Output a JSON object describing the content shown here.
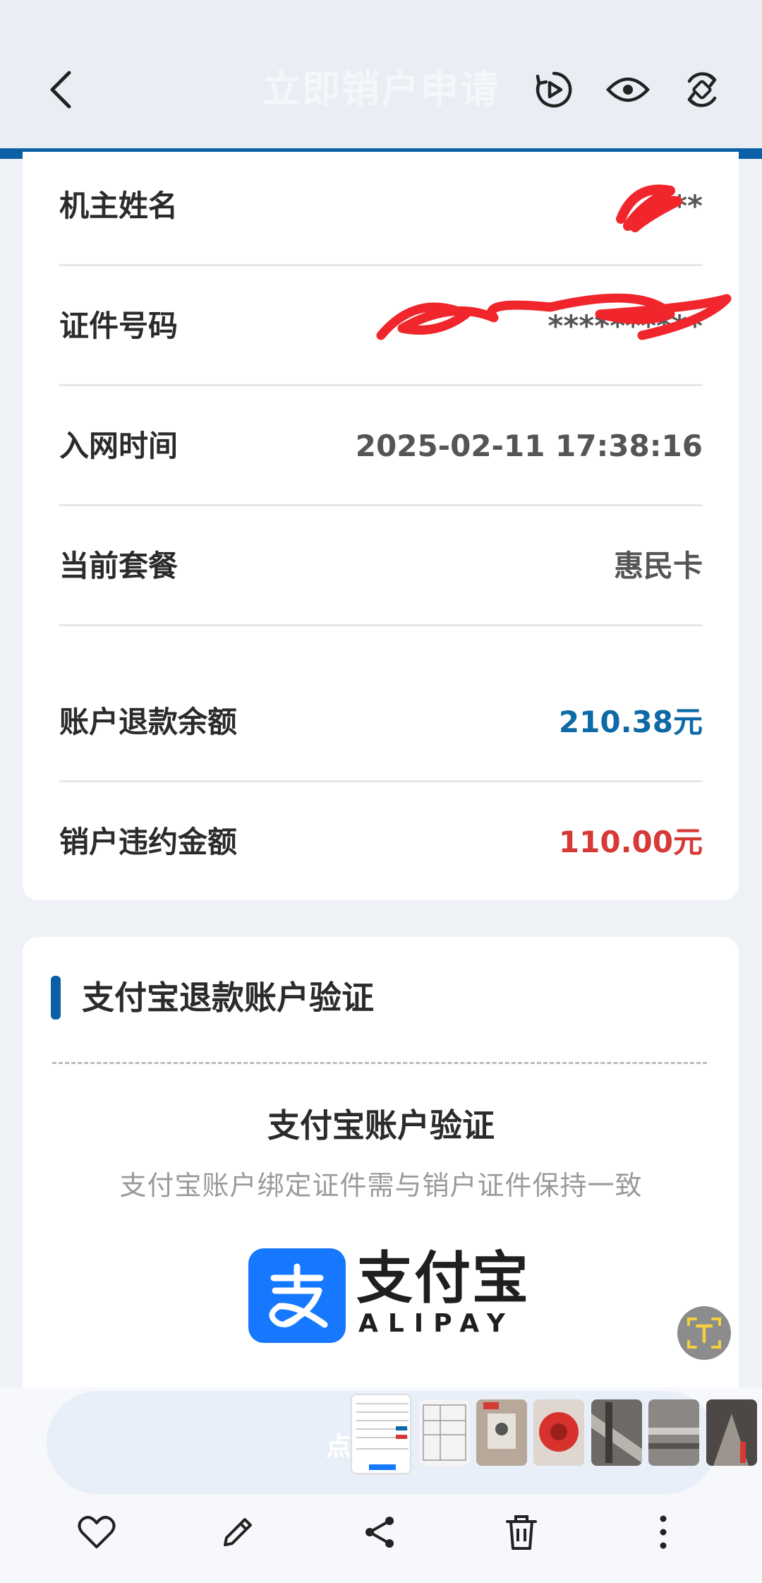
{
  "header": {
    "title": "立即销户申请"
  },
  "info": {
    "rows": [
      {
        "label": "机主姓名",
        "value": "**"
      },
      {
        "label": "证件号码",
        "value": "**********"
      },
      {
        "label": "入网时间",
        "value": "2025-02-11 17:38:16"
      },
      {
        "label": "当前套餐",
        "value": "惠民卡"
      },
      {
        "label": "账户退款余额",
        "value": "210.38元"
      },
      {
        "label": "销户违约金额",
        "value": "110.00元"
      }
    ]
  },
  "alipay_section": {
    "section_title": "支付宝退款账户验证",
    "verify_title": "支付宝账户验证",
    "verify_subtitle": "支付宝账户绑定证件需与销户证件保持一致",
    "logo_name": "支付宝",
    "logo_en": "ALIPAY"
  },
  "overlay": {
    "caption": "点"
  },
  "colors": {
    "accent_blue": "#0b5fa5",
    "refund_blue": "#0e6aa6",
    "penalty_red": "#d63a37",
    "alipay_blue": "#1677ff"
  },
  "icons": [
    "back-icon",
    "motion-photo-icon",
    "eye-icon",
    "rotate-icon",
    "ocr-text-icon",
    "heart-icon",
    "pencil-icon",
    "share-icon",
    "trash-icon",
    "more-vertical-icon"
  ]
}
